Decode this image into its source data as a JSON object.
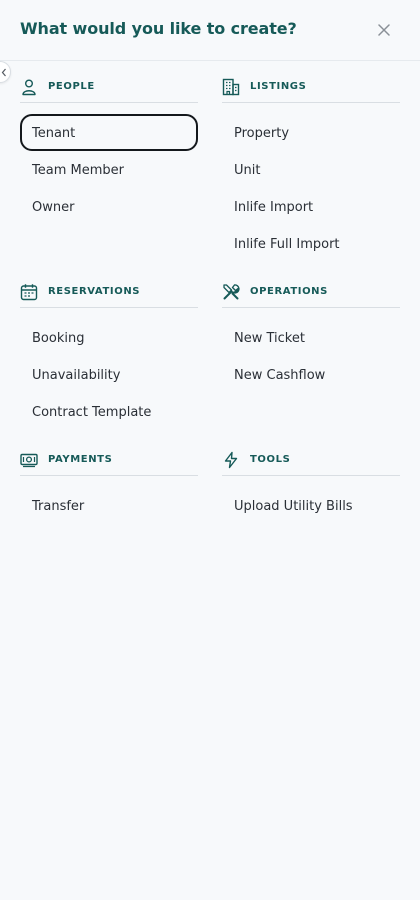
{
  "header": {
    "title": "What would you like to create?"
  },
  "sections": {
    "people": {
      "label": "PEOPLE",
      "items": [
        "Tenant",
        "Team Member",
        "Owner"
      ]
    },
    "listings": {
      "label": "LISTINGS",
      "items": [
        "Property",
        "Unit",
        "Inlife Import",
        "Inlife Full Import"
      ]
    },
    "reservations": {
      "label": "RESERVATIONS",
      "items": [
        "Booking",
        "Unavailability",
        "Contract Template"
      ]
    },
    "operations": {
      "label": "OPERATIONS",
      "items": [
        "New Ticket",
        "New Cashflow"
      ]
    },
    "payments": {
      "label": "PAYMENTS",
      "items": [
        "Transfer"
      ]
    },
    "tools": {
      "label": "TOOLS",
      "items": [
        "Upload Utility Bills"
      ]
    }
  },
  "icons": {
    "close": "close-icon",
    "collapse": "chevron-left-icon",
    "people": "person-icon",
    "listings": "building-icon",
    "reservations": "calendar-icon",
    "operations": "tools-icon",
    "payments": "banknote-icon",
    "tools": "lightning-icon"
  },
  "colors": {
    "accent": "#165a58",
    "background": "#f7f9fb",
    "divider": "#d9dee3",
    "focus_ring": "#14181c"
  }
}
